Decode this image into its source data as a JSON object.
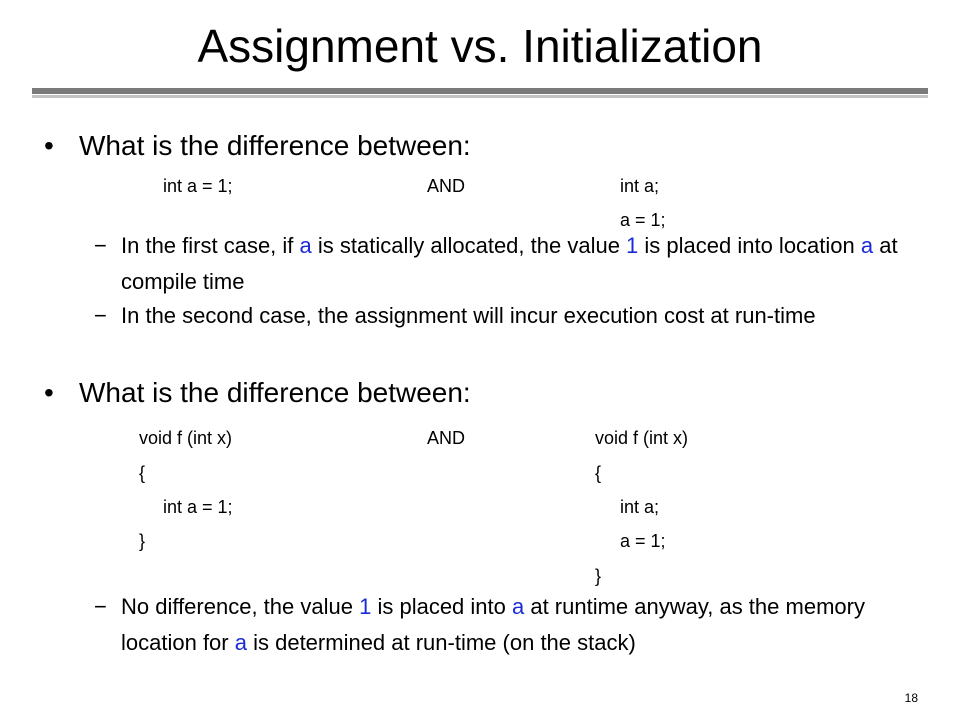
{
  "slide": {
    "title": "Assignment vs. Initialization",
    "page_number": "18"
  },
  "section1": {
    "bullet_symbol": "•",
    "heading": "What is the difference between:",
    "left_code": [
      "int a = 1;"
    ],
    "connector": "AND",
    "right_code": [
      "int a;",
      "a = 1;"
    ],
    "points": [
      {
        "dash": "−",
        "parts": [
          "In the first case, if ",
          "a",
          " is statically allocated, the value ",
          "1",
          " is placed into location ",
          "a",
          " at compile time"
        ]
      },
      {
        "dash": "−",
        "text": "In the second case, the assignment will incur execution cost at run-time"
      }
    ]
  },
  "section2": {
    "bullet_symbol": "•",
    "heading": "What is the difference between:",
    "left_code": [
      "void f (int x)",
      "{",
      "int a = 1;",
      "}"
    ],
    "connector": "AND",
    "right_code": [
      "void f (int x)",
      "{",
      "int a;",
      "a = 1;",
      "}"
    ],
    "points": [
      {
        "dash": "−",
        "parts": [
          "No difference, the value ",
          "1",
          " is placed into ",
          "a",
          " at runtime anyway, as the memory location for ",
          "a",
          " is determined at run-time (on the stack)"
        ]
      }
    ]
  },
  "colors": {
    "highlight": "#1a2bd8",
    "rule_dark": "#7a7a7a",
    "rule_light": "#c4c4c4"
  }
}
